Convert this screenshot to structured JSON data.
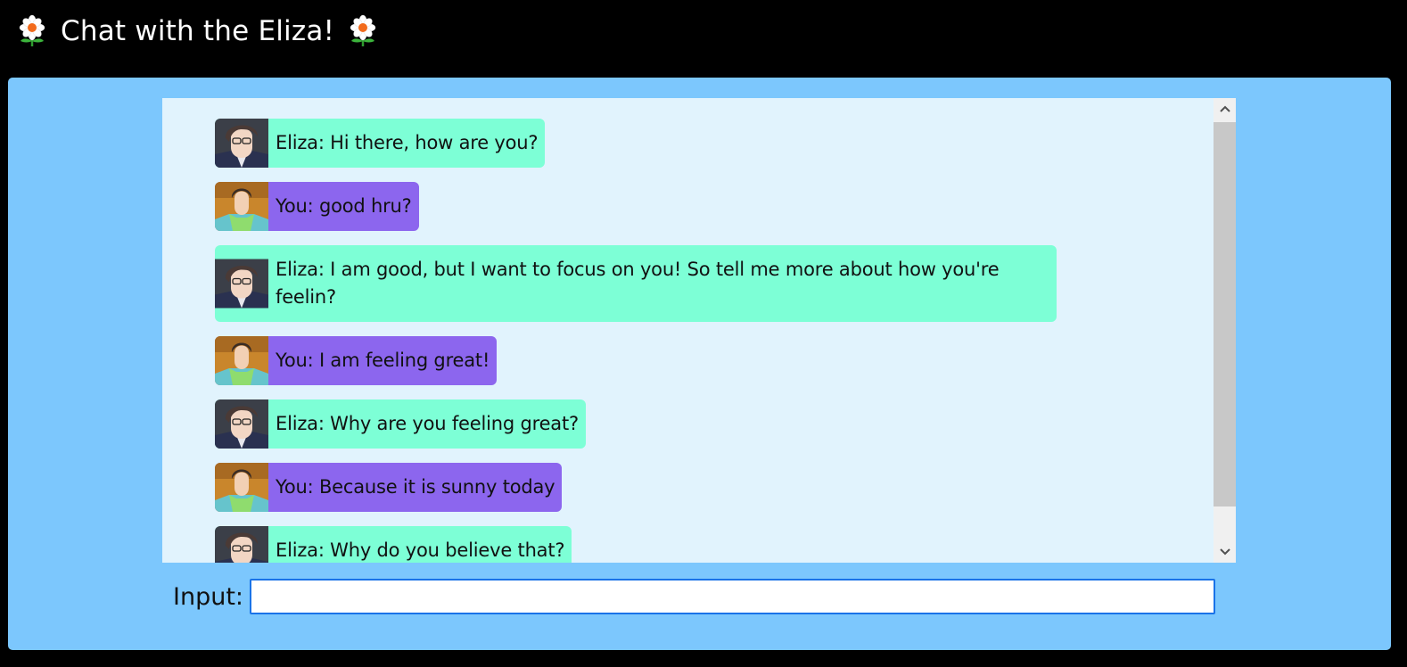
{
  "header": {
    "title": "Chat with the Eliza!",
    "icon_left": "flower-icon",
    "icon_right": "flower-icon"
  },
  "colors": {
    "page_background": "#000000",
    "panel_background": "#7cc7fd",
    "chat_background": "#e1f3fd",
    "eliza_bubble": "#7dffd6",
    "you_bubble": "#8c66ee",
    "input_border": "#1a73e8"
  },
  "chat": {
    "messages": [
      {
        "speaker": "eliza",
        "avatar": "eliza-avatar",
        "text": "Eliza: Hi there, how are you?"
      },
      {
        "speaker": "you",
        "avatar": "user-avatar",
        "text": "You: good hru?"
      },
      {
        "speaker": "eliza",
        "avatar": "eliza-avatar",
        "text": "Eliza: I am good, but I want to focus on you! So tell me more about how you're feelin?"
      },
      {
        "speaker": "you",
        "avatar": "user-avatar",
        "text": "You: I am feeling great!"
      },
      {
        "speaker": "eliza",
        "avatar": "eliza-avatar",
        "text": "Eliza: Why are you feeling great?"
      },
      {
        "speaker": "you",
        "avatar": "user-avatar",
        "text": "You: Because it is sunny today"
      },
      {
        "speaker": "eliza",
        "avatar": "eliza-avatar",
        "text": "Eliza: Why do you believe that?"
      }
    ]
  },
  "input": {
    "label": "Input:",
    "value": "",
    "placeholder": ""
  }
}
